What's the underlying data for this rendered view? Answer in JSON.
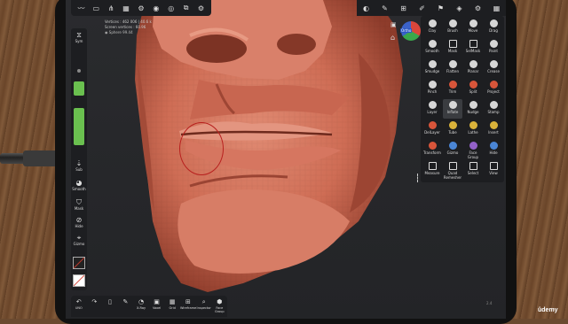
{
  "stats": {
    "line1": "Vertices : 462 006 | 40.6 k",
    "line2": "Screen vertices : 60.96",
    "object_name": "Sphere",
    "object_count": "99.44"
  },
  "topbar_icons": [
    "logo-icon",
    "folder-icon",
    "scene-icon",
    "grid-icon",
    "settings-icon",
    "material-icon",
    "camera-icon",
    "record-icon",
    "gear-icon"
  ],
  "gizmo": {
    "label": "Ortho"
  },
  "leftbar": {
    "sym_label": "Sym",
    "sub_label": "Sub",
    "smooth_label": "Smooth",
    "mask_label": "Mask",
    "hide_label": "Hide",
    "gizmo_label": "Gizmo",
    "accent_color": "#6ac04f"
  },
  "bottombar": {
    "items": [
      {
        "icon": "undo-icon",
        "label": "UNO"
      },
      {
        "icon": "redo-icon",
        "label": ""
      },
      {
        "icon": "ipad-icon",
        "label": ""
      },
      {
        "icon": "pen-icon",
        "label": ""
      },
      {
        "icon": "xray-icon",
        "label": "X-Ray"
      },
      {
        "icon": "voxel-icon",
        "label": "Voxel"
      },
      {
        "icon": "grid-icon",
        "label": "Grid"
      },
      {
        "icon": "wireframe-icon",
        "label": "Wireframe"
      },
      {
        "icon": "inspector-icon",
        "label": "Inspector"
      },
      {
        "icon": "face-group-icon",
        "label": "Face Group"
      }
    ]
  },
  "tools": [
    {
      "label": "Clay",
      "kind": ""
    },
    {
      "label": "Brush",
      "kind": ""
    },
    {
      "label": "Move",
      "kind": ""
    },
    {
      "label": "Drag",
      "kind": ""
    },
    {
      "label": "Smooth",
      "kind": ""
    },
    {
      "label": "Mask",
      "kind": "sq"
    },
    {
      "label": "SelMask",
      "kind": "sq"
    },
    {
      "label": "Paint",
      "kind": ""
    },
    {
      "label": "Smudge",
      "kind": ""
    },
    {
      "label": "Flatten",
      "kind": ""
    },
    {
      "label": "Planar",
      "kind": ""
    },
    {
      "label": "Crease",
      "kind": ""
    },
    {
      "label": "Pinch",
      "kind": ""
    },
    {
      "label": "Trim",
      "kind": "red"
    },
    {
      "label": "Split",
      "kind": "red"
    },
    {
      "label": "Project",
      "kind": "red"
    },
    {
      "label": "Layer",
      "kind": ""
    },
    {
      "label": "Inflate",
      "kind": ""
    },
    {
      "label": "Nudge",
      "kind": ""
    },
    {
      "label": "Stamp",
      "kind": ""
    },
    {
      "label": "DelLayer",
      "kind": "red"
    },
    {
      "label": "Tube",
      "kind": "yel"
    },
    {
      "label": "Lathe",
      "kind": "yel"
    },
    {
      "label": "Insert",
      "kind": "yel"
    },
    {
      "label": "Transform",
      "kind": "red"
    },
    {
      "label": "Gizmo",
      "kind": "blu"
    },
    {
      "label": "Face Group",
      "kind": "pur"
    },
    {
      "label": "Hide",
      "kind": "blu"
    },
    {
      "label": "Measure",
      "kind": "sq"
    },
    {
      "label": "Quad Remesher",
      "kind": "sq"
    },
    {
      "label": "Select",
      "kind": "sq"
    },
    {
      "label": "View",
      "kind": "sq"
    }
  ],
  "active_tool": "Inflate",
  "version_text": "2.4",
  "watermark": "ûdemy",
  "colors": {
    "sculpt": "#d4715a",
    "sculpt_shadow": "#8c3d2c",
    "brush_circle": "#b8201e",
    "panel_bg": "#1d1e21",
    "viewport_bg": "#26272a"
  }
}
